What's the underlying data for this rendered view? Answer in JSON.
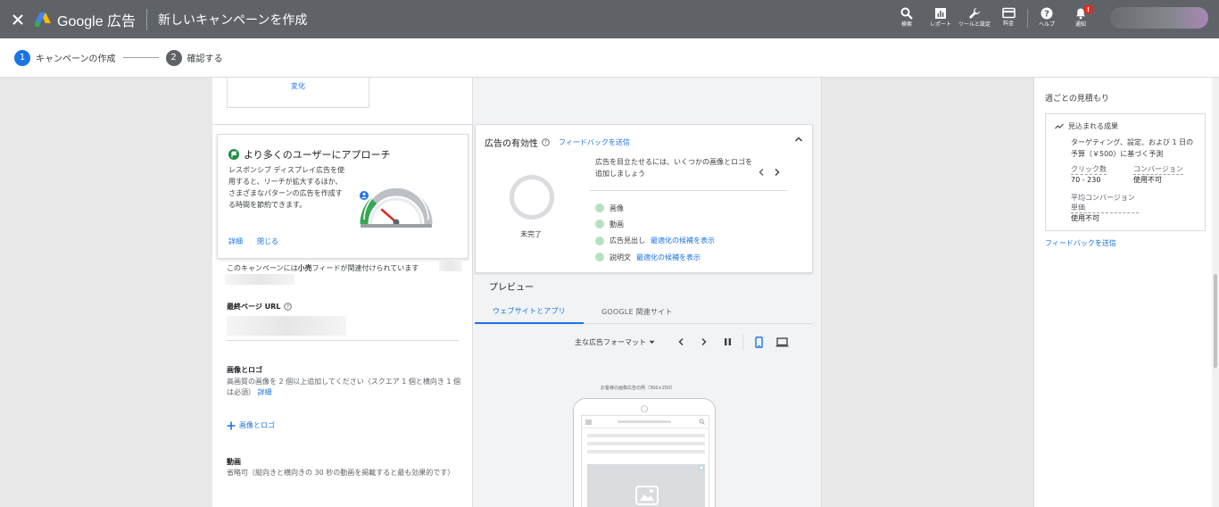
{
  "appbar": {
    "brand": "Google 広告",
    "title": "新しいキャンペーンを作成",
    "tools": [
      {
        "name": "search",
        "label": "検索"
      },
      {
        "name": "reports",
        "label": "レポート"
      },
      {
        "name": "tools",
        "label": "ツールと設定"
      },
      {
        "name": "billing",
        "label": "料金"
      },
      {
        "name": "help",
        "label": "ヘルプ"
      },
      {
        "name": "notifications",
        "label": "通知"
      }
    ],
    "notification_badge": "!"
  },
  "stepper": {
    "steps": [
      {
        "num": "1",
        "label": "キャンペーンの作成"
      },
      {
        "num": "2",
        "label": "確認する"
      }
    ]
  },
  "left": {
    "change_link": "変化",
    "promo": {
      "title": "より多くのユーザーにアプローチ",
      "description": "レスポンシブ ディスプレイ広告を使用すると、リーチが拡大するほか、さまざまなパターンの広告を作成する時間を節約できます。",
      "details_link": "詳細",
      "close_link": "閉じる"
    },
    "feed": {
      "pre": "このキャンペーンには",
      "bold": "小売",
      "post": "フィードが関連付けられています"
    },
    "final_url_label": "最終ページ URL",
    "images": {
      "title": "画像とロゴ",
      "description": "高画質の画像を 2 個以上追加してください（スクエア 1 個と横向き 1 個は必須）",
      "details_link": "詳細",
      "add_label": "画像とロゴ"
    },
    "videos": {
      "title": "動画",
      "description": "省略可（縦向きと横向きの 30 秒の動画を掲載すると最も効果的です）"
    }
  },
  "strength": {
    "title": "広告の有効性",
    "feedback_link": "フィードバックを送信",
    "status": "未完了",
    "tip": "広告を目立たせるには、いくつかの画像とロゴを追加しましょう",
    "items": [
      {
        "label": "画像",
        "link": ""
      },
      {
        "label": "動画",
        "link": ""
      },
      {
        "label": "広告見出し",
        "link": "最適化の候補を表示"
      },
      {
        "label": "説明文",
        "link": "最適化の候補を表示"
      }
    ]
  },
  "preview": {
    "title": "プレビュー",
    "tabs": [
      "ウェブサイトとアプリ",
      "GOOGLE 関連サイト"
    ],
    "format_select": "主な広告フォーマット",
    "caption": "お客様の画像広告の例（300×250）"
  },
  "side": {
    "title": "週ごとの見積もり",
    "results_label": "見込まれる成果",
    "basis": "ターゲティング、設定、および 1 日の予算（￥500）に基づく予測",
    "metrics": [
      {
        "key": "クリック数",
        "value": "70 - 230"
      },
      {
        "key": "コンバージョン",
        "value": "使用不可"
      },
      {
        "key": "平均コンバージョン単価",
        "value": "使用不可"
      }
    ],
    "feedback_link": "フィードバックを送信"
  },
  "colors": {
    "appbar": "#5f6368",
    "accent": "#1a73e8",
    "success": "#1e8e3e",
    "badge": "#d93025"
  }
}
